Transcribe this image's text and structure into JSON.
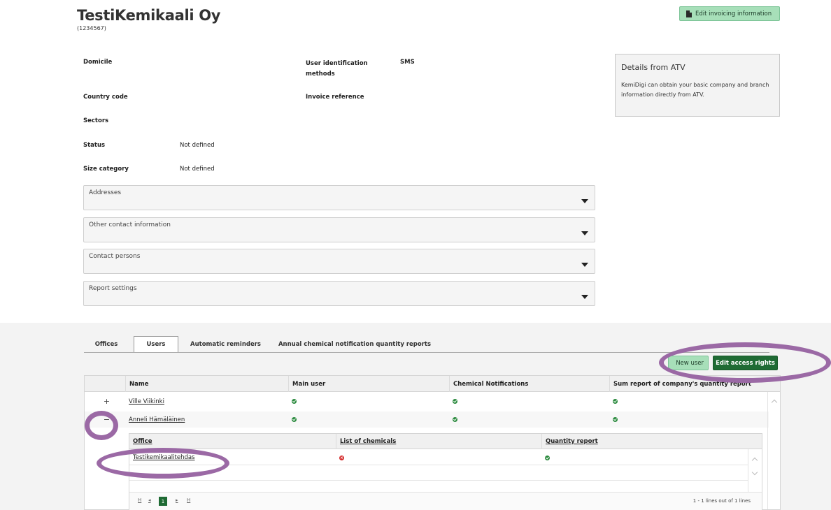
{
  "company": {
    "name": "TestiKemikaali Oy",
    "id": "(1234567)"
  },
  "buttons": {
    "edit_invoicing": "Edit invoicing information",
    "new_user": "New user",
    "edit_access": "Edit access rights"
  },
  "details": {
    "domicile_label": "Domicile",
    "domicile_value": "",
    "country_label": "Country code",
    "country_value": "",
    "sectors_label": "Sectors",
    "status_label": "Status",
    "status_value": "Not defined",
    "size_label": "Size category",
    "size_value": "Not defined",
    "uid_label": "User identification methods",
    "uid_value": "SMS",
    "invoice_ref_label": "Invoice reference",
    "invoice_ref_value": ""
  },
  "atv": {
    "title": "Details from ATV",
    "text": "KemiDigi can obtain your basic company and branch information directly from ATV."
  },
  "accordions": [
    "Addresses",
    "Other contact information",
    "Contact persons",
    "Report settings"
  ],
  "tabs": [
    "Offices",
    "Users",
    "Automatic reminders",
    "Annual chemical notification quantity reports"
  ],
  "active_tab": "Users",
  "users_table": {
    "columns": [
      "Name",
      "Main user",
      "Chemical Notifications",
      "Sum report of company's quantity report"
    ],
    "rows": [
      {
        "expander": "+",
        "name": "Ville Viikinki",
        "main_user": "ok",
        "chem": "ok",
        "sum": "ok"
      },
      {
        "expander": "−",
        "name": "Anneli Hämäläinen",
        "main_user": "ok",
        "chem": "ok",
        "sum": "ok"
      }
    ]
  },
  "offices_table": {
    "columns": [
      "Office",
      "List of chemicals",
      "Quantity report"
    ],
    "rows": [
      {
        "office": "Testikemikaalitehdas",
        "list": "error",
        "quantity": "ok"
      }
    ],
    "pager": {
      "first": "H",
      "prev": "◂",
      "current": "1",
      "next": "▸",
      "last": "H",
      "info": "1 - 1 lines out of 1 lines"
    }
  },
  "colors": {
    "accent_light": "#a7dfb9",
    "accent_dark": "#1f6b34",
    "highlight": "#9b69a5",
    "ok": "#2b8a3e",
    "error": "#d42a2a"
  }
}
